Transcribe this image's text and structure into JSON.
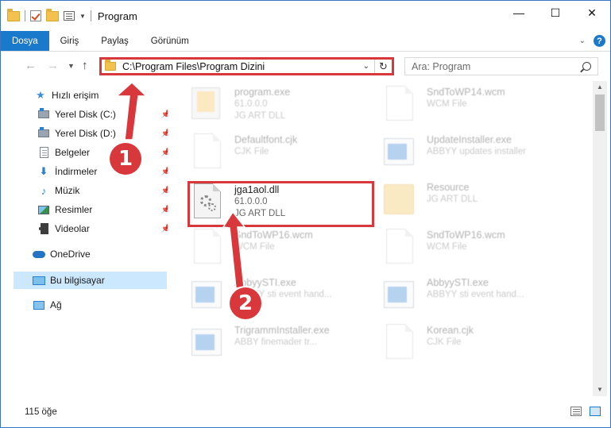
{
  "window": {
    "title": "Program",
    "controls": {
      "minimize": "—",
      "maximize": "☐",
      "close": "✕"
    }
  },
  "ribbon": {
    "tabs": [
      {
        "label": "Dosya",
        "active": true
      },
      {
        "label": "Giriş"
      },
      {
        "label": "Paylaş"
      },
      {
        "label": "Görünüm"
      }
    ],
    "expand_icon": "chevron-down-icon",
    "help": "?"
  },
  "address": {
    "path": "C:\\Program Files\\Program Dizini",
    "highlight_color": "#d8383b"
  },
  "search": {
    "placeholder": "Ara: Program"
  },
  "sidebar": {
    "items": [
      {
        "label": "Hızlı erişim",
        "icon": "star-icon"
      },
      {
        "label": "Yerel Disk (C:)",
        "icon": "drive-icon",
        "pinned": true
      },
      {
        "label": "Yerel Disk (D:)",
        "icon": "drive-icon",
        "pinned": true
      },
      {
        "label": "Belgeler",
        "icon": "document-icon",
        "pinned": true
      },
      {
        "label": "İndirmeler",
        "icon": "download-icon",
        "pinned": true
      },
      {
        "label": "Müzik",
        "icon": "music-icon",
        "pinned": true
      },
      {
        "label": "Resimler",
        "icon": "picture-icon",
        "pinned": true
      },
      {
        "label": "Videolar",
        "icon": "video-icon",
        "pinned": true
      },
      {
        "label": "OneDrive",
        "icon": "cloud-icon"
      },
      {
        "label": "Bu bilgisayar",
        "icon": "computer-icon",
        "selected": true
      },
      {
        "label": "Ağ",
        "icon": "network-icon"
      }
    ]
  },
  "files": [
    {
      "name": "program.exe",
      "line2": "61.0.0.0",
      "line3": "JG ART DLL",
      "icon": "exe-icon"
    },
    {
      "name": "SndToWP14.wcm",
      "line2": "WCM File",
      "line3": "",
      "icon": "file-icon"
    },
    {
      "name": "Defaultfont.cjk",
      "line2": "CJK File",
      "line3": "",
      "icon": "file-icon"
    },
    {
      "name": "UpdateInstaller.exe",
      "line2": "ABBYY updates installer",
      "line3": "",
      "icon": "window-app-icon"
    },
    {
      "name": "jga1aol.dll",
      "line2": "61.0.0.0",
      "line3": "JG ART DLL",
      "icon": "dll-icon",
      "highlighted": true
    },
    {
      "name": "Resource",
      "line2": "JG ART DLL",
      "line3": "",
      "icon": "folder-icon"
    },
    {
      "name": "SndToWP16.wcm",
      "line2": "WCM File",
      "line3": "",
      "icon": "file-icon"
    },
    {
      "name": "SndToWP16.wcm",
      "line2": "WCM File",
      "line3": "",
      "icon": "file-icon"
    },
    {
      "name": "AbbyySTI.exe",
      "line2": "ABBYY sti event hand...",
      "line3": "",
      "icon": "window-app-icon"
    },
    {
      "name": "AbbyySTI.exe",
      "line2": "ABBYY sti event hand...",
      "line3": "",
      "icon": "window-app-icon"
    },
    {
      "name": "TrigrammInstaller.exe",
      "line2": "ABBY finemader tr...",
      "line3": "",
      "icon": "window-app-icon"
    },
    {
      "name": "Korean.cjk",
      "line2": "CJK File",
      "line3": "",
      "icon": "file-icon"
    }
  ],
  "status": {
    "item_count": "115 öğe"
  },
  "annotations": {
    "step1": "1",
    "step2": "2",
    "color": "#d8383b"
  }
}
